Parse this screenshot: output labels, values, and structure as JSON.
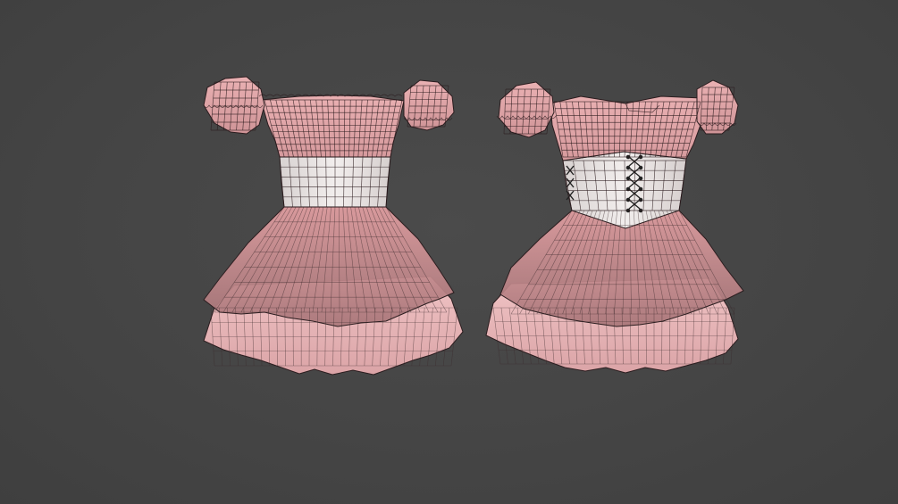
{
  "viewport": {
    "background_color": "#444444"
  },
  "models": [
    {
      "id": "dress-front",
      "description_colors": {
        "top": "#e6a9ac",
        "corset": "#ece7e6",
        "skirt_outer": "#c98f92",
        "skirt_inner": "#e8b4b6",
        "wireframe": "#2a1a1c"
      }
    },
    {
      "id": "dress-back",
      "description_colors": {
        "top": "#e3a4a8",
        "corset": "#eae4e3",
        "skirt_outer": "#c68c90",
        "skirt_inner": "#e6b1b4",
        "lacing": "#222222"
      }
    }
  ]
}
